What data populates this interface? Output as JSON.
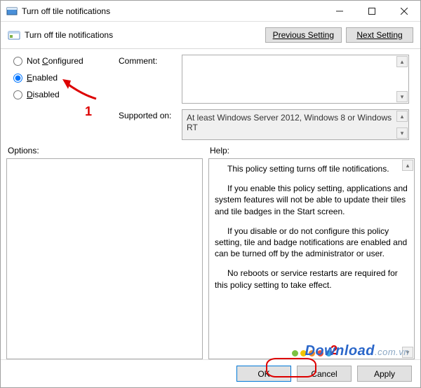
{
  "window": {
    "title": "Turn off tile notifications"
  },
  "subheader": {
    "title": "Turn off tile notifications"
  },
  "nav": {
    "previous": "Previous Setting",
    "next": "Next Setting"
  },
  "radios": {
    "not_configured": "Not Configured",
    "enabled": "Enabled",
    "disabled": "Disabled",
    "selected": "enabled"
  },
  "labels": {
    "comment": "Comment:",
    "supported_on": "Supported on:",
    "options": "Options:",
    "help": "Help:"
  },
  "supported_on_value": "At least Windows Server 2012, Windows 8 or Windows RT",
  "help_paragraphs": {
    "p1": "This policy setting turns off tile notifications.",
    "p2": "If you enable this policy setting, applications and system features will not be able to update their tiles and tile badges in the Start screen.",
    "p3": "If you disable or do not configure this policy setting, tile and badge notifications are enabled and can be turned off by the administrator or user.",
    "p4": "No reboots or service restarts are required for this policy setting to take effect."
  },
  "buttons": {
    "ok": "OK",
    "cancel": "Cancel",
    "apply": "Apply"
  },
  "annotations": {
    "num1": "1",
    "num2": "2"
  },
  "watermark": {
    "brand": "Download",
    "suffix": ".com.vn"
  }
}
